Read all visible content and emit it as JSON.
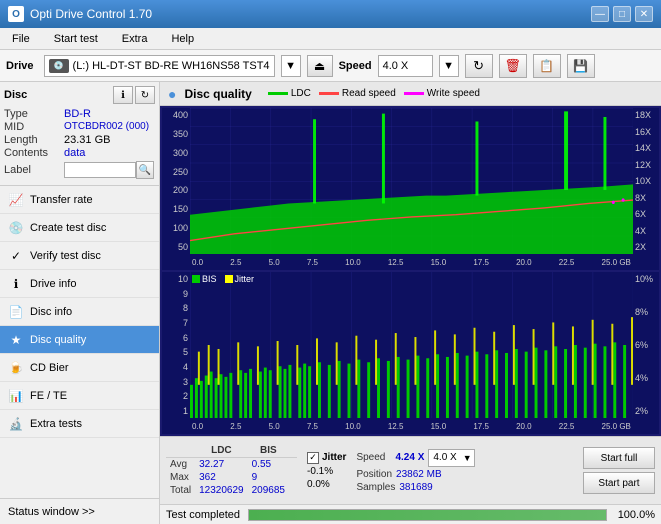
{
  "app": {
    "title": "Opti Drive Control 1.70",
    "icon": "O"
  },
  "titlebar": {
    "minimize": "—",
    "maximize": "□",
    "close": "✕"
  },
  "menu": {
    "items": [
      "File",
      "Start test",
      "Extra",
      "Help"
    ]
  },
  "drivebar": {
    "drive_label": "Drive",
    "drive_name": "(L:)  HL-DT-ST BD-RE  WH16NS58 TST4",
    "speed_label": "Speed",
    "speed_value": "4.0 X"
  },
  "sidebar": {
    "disc_title": "Disc",
    "disc_type_label": "Type",
    "disc_type_value": "BD-R",
    "disc_mid_label": "MID",
    "disc_mid_value": "OTCBDR002 (000)",
    "disc_length_label": "Length",
    "disc_length_value": "23.31 GB",
    "disc_contents_label": "Contents",
    "disc_contents_value": "data",
    "disc_label_label": "Label",
    "disc_label_value": "",
    "nav_items": [
      {
        "id": "transfer-rate",
        "label": "Transfer rate",
        "icon": "📈"
      },
      {
        "id": "create-test-disc",
        "label": "Create test disc",
        "icon": "💿"
      },
      {
        "id": "verify-test-disc",
        "label": "Verify test disc",
        "icon": "✓"
      },
      {
        "id": "drive-info",
        "label": "Drive info",
        "icon": "ℹ"
      },
      {
        "id": "disc-info",
        "label": "Disc info",
        "icon": "📄"
      },
      {
        "id": "disc-quality",
        "label": "Disc quality",
        "icon": "★",
        "active": true
      },
      {
        "id": "cd-bier",
        "label": "CD Bier",
        "icon": "🍺"
      },
      {
        "id": "fe-te",
        "label": "FE / TE",
        "icon": "📊"
      },
      {
        "id": "extra-tests",
        "label": "Extra tests",
        "icon": "🔬"
      }
    ],
    "status_window_label": "Status window >>"
  },
  "chart": {
    "title": "Disc quality",
    "top_legend": {
      "ldc_label": "LDC",
      "read_label": "Read speed",
      "write_label": "Write speed"
    },
    "top_y_labels_left": [
      "400",
      "350",
      "300",
      "250",
      "200",
      "150",
      "100",
      "50"
    ],
    "top_y_labels_right": [
      "18X",
      "16X",
      "14X",
      "12X",
      "10X",
      "8X",
      "6X",
      "4X",
      "2X"
    ],
    "top_x_labels": [
      "0.0",
      "2.5",
      "5.0",
      "7.5",
      "10.0",
      "12.5",
      "15.0",
      "17.5",
      "20.0",
      "22.5",
      "25.0 GB"
    ],
    "bottom_legend": {
      "bis_label": "BIS",
      "jitter_label": "Jitter"
    },
    "bottom_y_labels_left": [
      "10",
      "9",
      "8",
      "7",
      "6",
      "5",
      "4",
      "3",
      "2",
      "1"
    ],
    "bottom_y_labels_right": [
      "10%",
      "8%",
      "6%",
      "4%",
      "2%"
    ],
    "bottom_x_labels": [
      "0.0",
      "2.5",
      "5.0",
      "7.5",
      "10.0",
      "12.5",
      "15.0",
      "17.5",
      "20.0",
      "22.5",
      "25.0 GB"
    ]
  },
  "stats": {
    "headers": [
      "",
      "LDC",
      "BIS",
      "",
      "Jitter",
      "Speed"
    ],
    "rows": [
      {
        "label": "Avg",
        "ldc": "32.27",
        "bis": "0.55",
        "jitter": "-0.1%",
        "speed_label": "",
        "speed_value": "4.24 X"
      },
      {
        "label": "Max",
        "ldc": "362",
        "bis": "9",
        "jitter": "0.0%",
        "speed_label": "Position",
        "speed_value": "23862 MB"
      },
      {
        "label": "Total",
        "ldc": "12320629",
        "bis": "209685",
        "jitter": "",
        "speed_label": "Samples",
        "speed_value": "381689"
      }
    ],
    "speed_dropdown_value": "4.0 X",
    "start_full_label": "Start full",
    "start_part_label": "Start part"
  },
  "statusbar": {
    "status_text": "Test completed",
    "progress": 100,
    "progress_text": "100.0%"
  }
}
